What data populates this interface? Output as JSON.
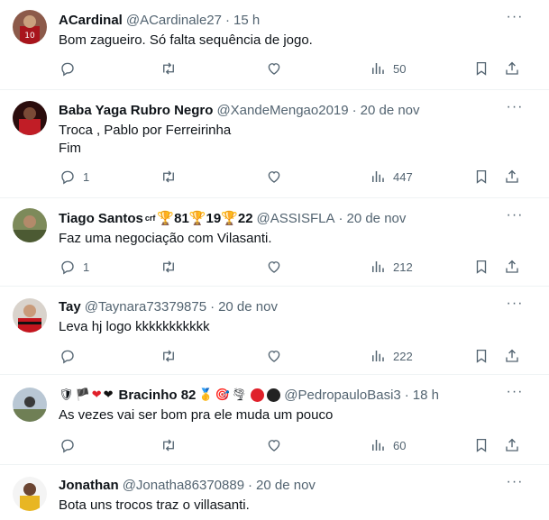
{
  "tweets": [
    {
      "name": "ACardinal",
      "handle": "@ACardinale27",
      "time": "15 h",
      "lines": [
        "Bom zagueiro. Só falta sequência de jogo."
      ],
      "replies": "",
      "likes": "",
      "views": "50"
    },
    {
      "name": "Baba Yaga Rubro Negro",
      "handle": "@XandeMengao2019",
      "time": "20 de nov",
      "lines": [
        "Troca , Pablo por Ferreirinha",
        "Fim"
      ],
      "replies": "1",
      "likes": "",
      "views": "447"
    },
    {
      "name": "Tiago Santos",
      "name_badges": {
        "crf": "crf",
        "cup1": "81",
        "cup2": "19",
        "cup3": "22"
      },
      "handle": "@ASSISFLA",
      "time": "20 de nov",
      "lines": [
        "Faz uma negociação com Vilasanti."
      ],
      "replies": "1",
      "likes": "",
      "views": "212"
    },
    {
      "name": "Tay",
      "handle": "@Taynara73379875",
      "time": "20 de nov",
      "lines": [
        "Leva hj logo kkkkkkkkkkk"
      ],
      "replies": "",
      "likes": "",
      "views": "222"
    },
    {
      "name": "Bracinho 82",
      "handle": "@PedropauloBasi3",
      "time": "18 h",
      "lines": [
        "As vezes vai ser bom pra ele muda um pouco"
      ],
      "replies": "",
      "likes": "",
      "views": "60"
    },
    {
      "name": "Jonathan",
      "handle": "@Jonatha86370889",
      "time": "20 de nov",
      "lines": [
        "Bota uns trocos traz o villasanti."
      ]
    }
  ],
  "separator": "·",
  "more_glyph": "···",
  "colors": {
    "text": "#0f1419",
    "muted": "#536471",
    "divider": "#eff3f4",
    "gold": "#d9a31a",
    "red": "#e0202a"
  }
}
